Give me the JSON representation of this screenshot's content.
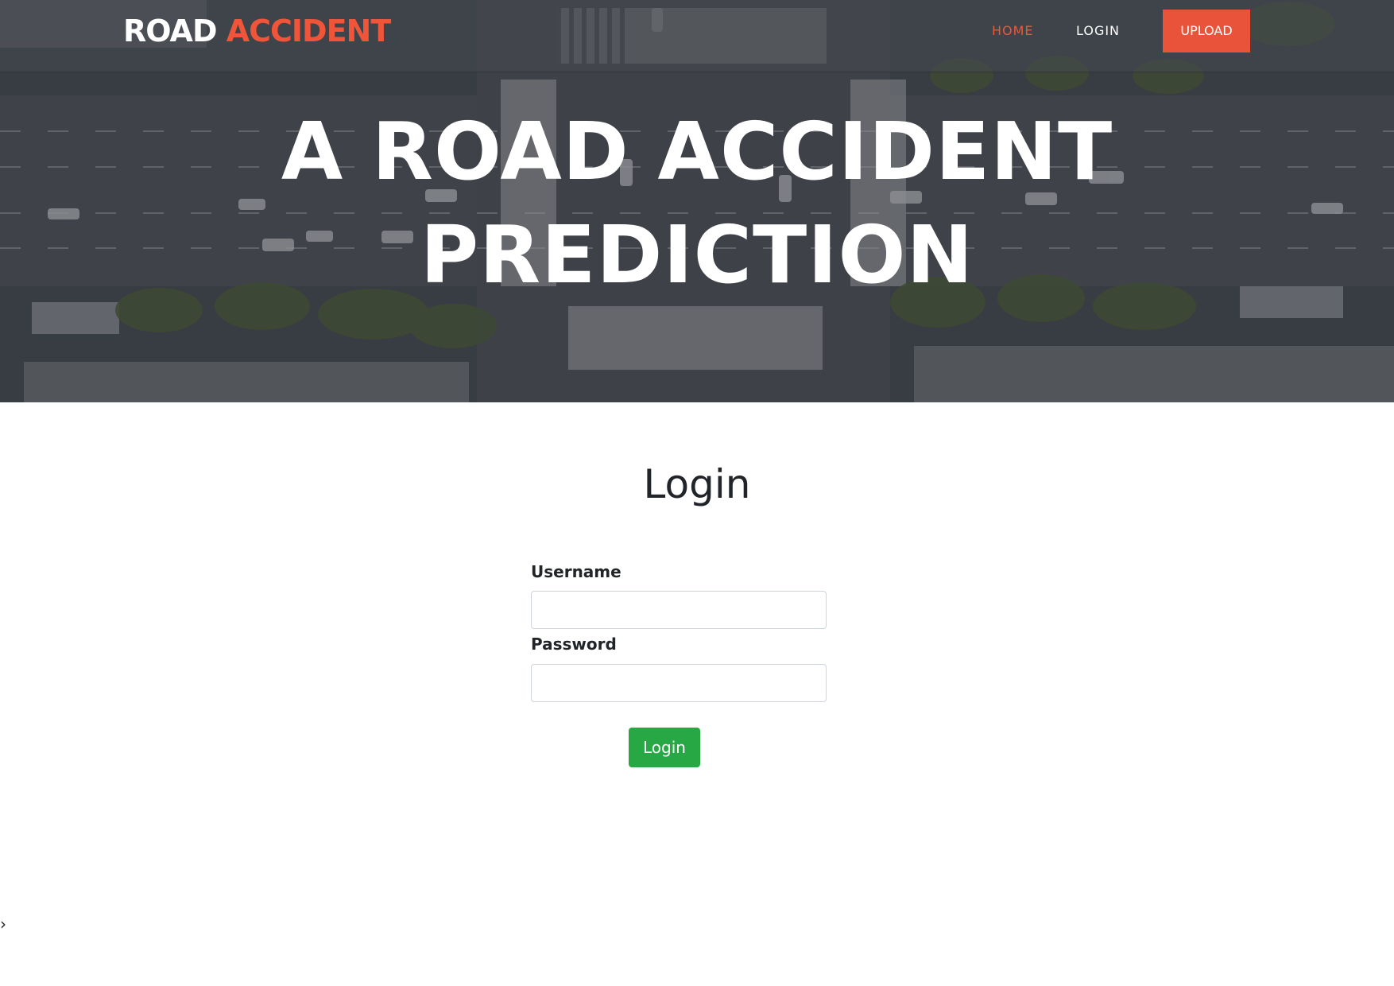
{
  "navbar": {
    "logo": {
      "part1": "ROAD",
      "part2": "ACCIDENT"
    },
    "links": {
      "home": "HOME",
      "login": "LOGIN"
    },
    "upload_label": "UPLOAD"
  },
  "hero": {
    "title_line1": "A ROAD ACCIDENT",
    "title_line2": "PREDICTION"
  },
  "login": {
    "heading": "Login",
    "username_label": "Username",
    "username_value": "",
    "password_label": "Password",
    "password_value": "",
    "submit_label": "Login"
  },
  "misc": {
    "chevron": "›"
  },
  "colors": {
    "accent": "#f0553a",
    "upload_bg": "#e8533a",
    "login_button": "#28a745",
    "heading_text": "#212529"
  },
  "icons": [
    "chevron-right-icon"
  ]
}
